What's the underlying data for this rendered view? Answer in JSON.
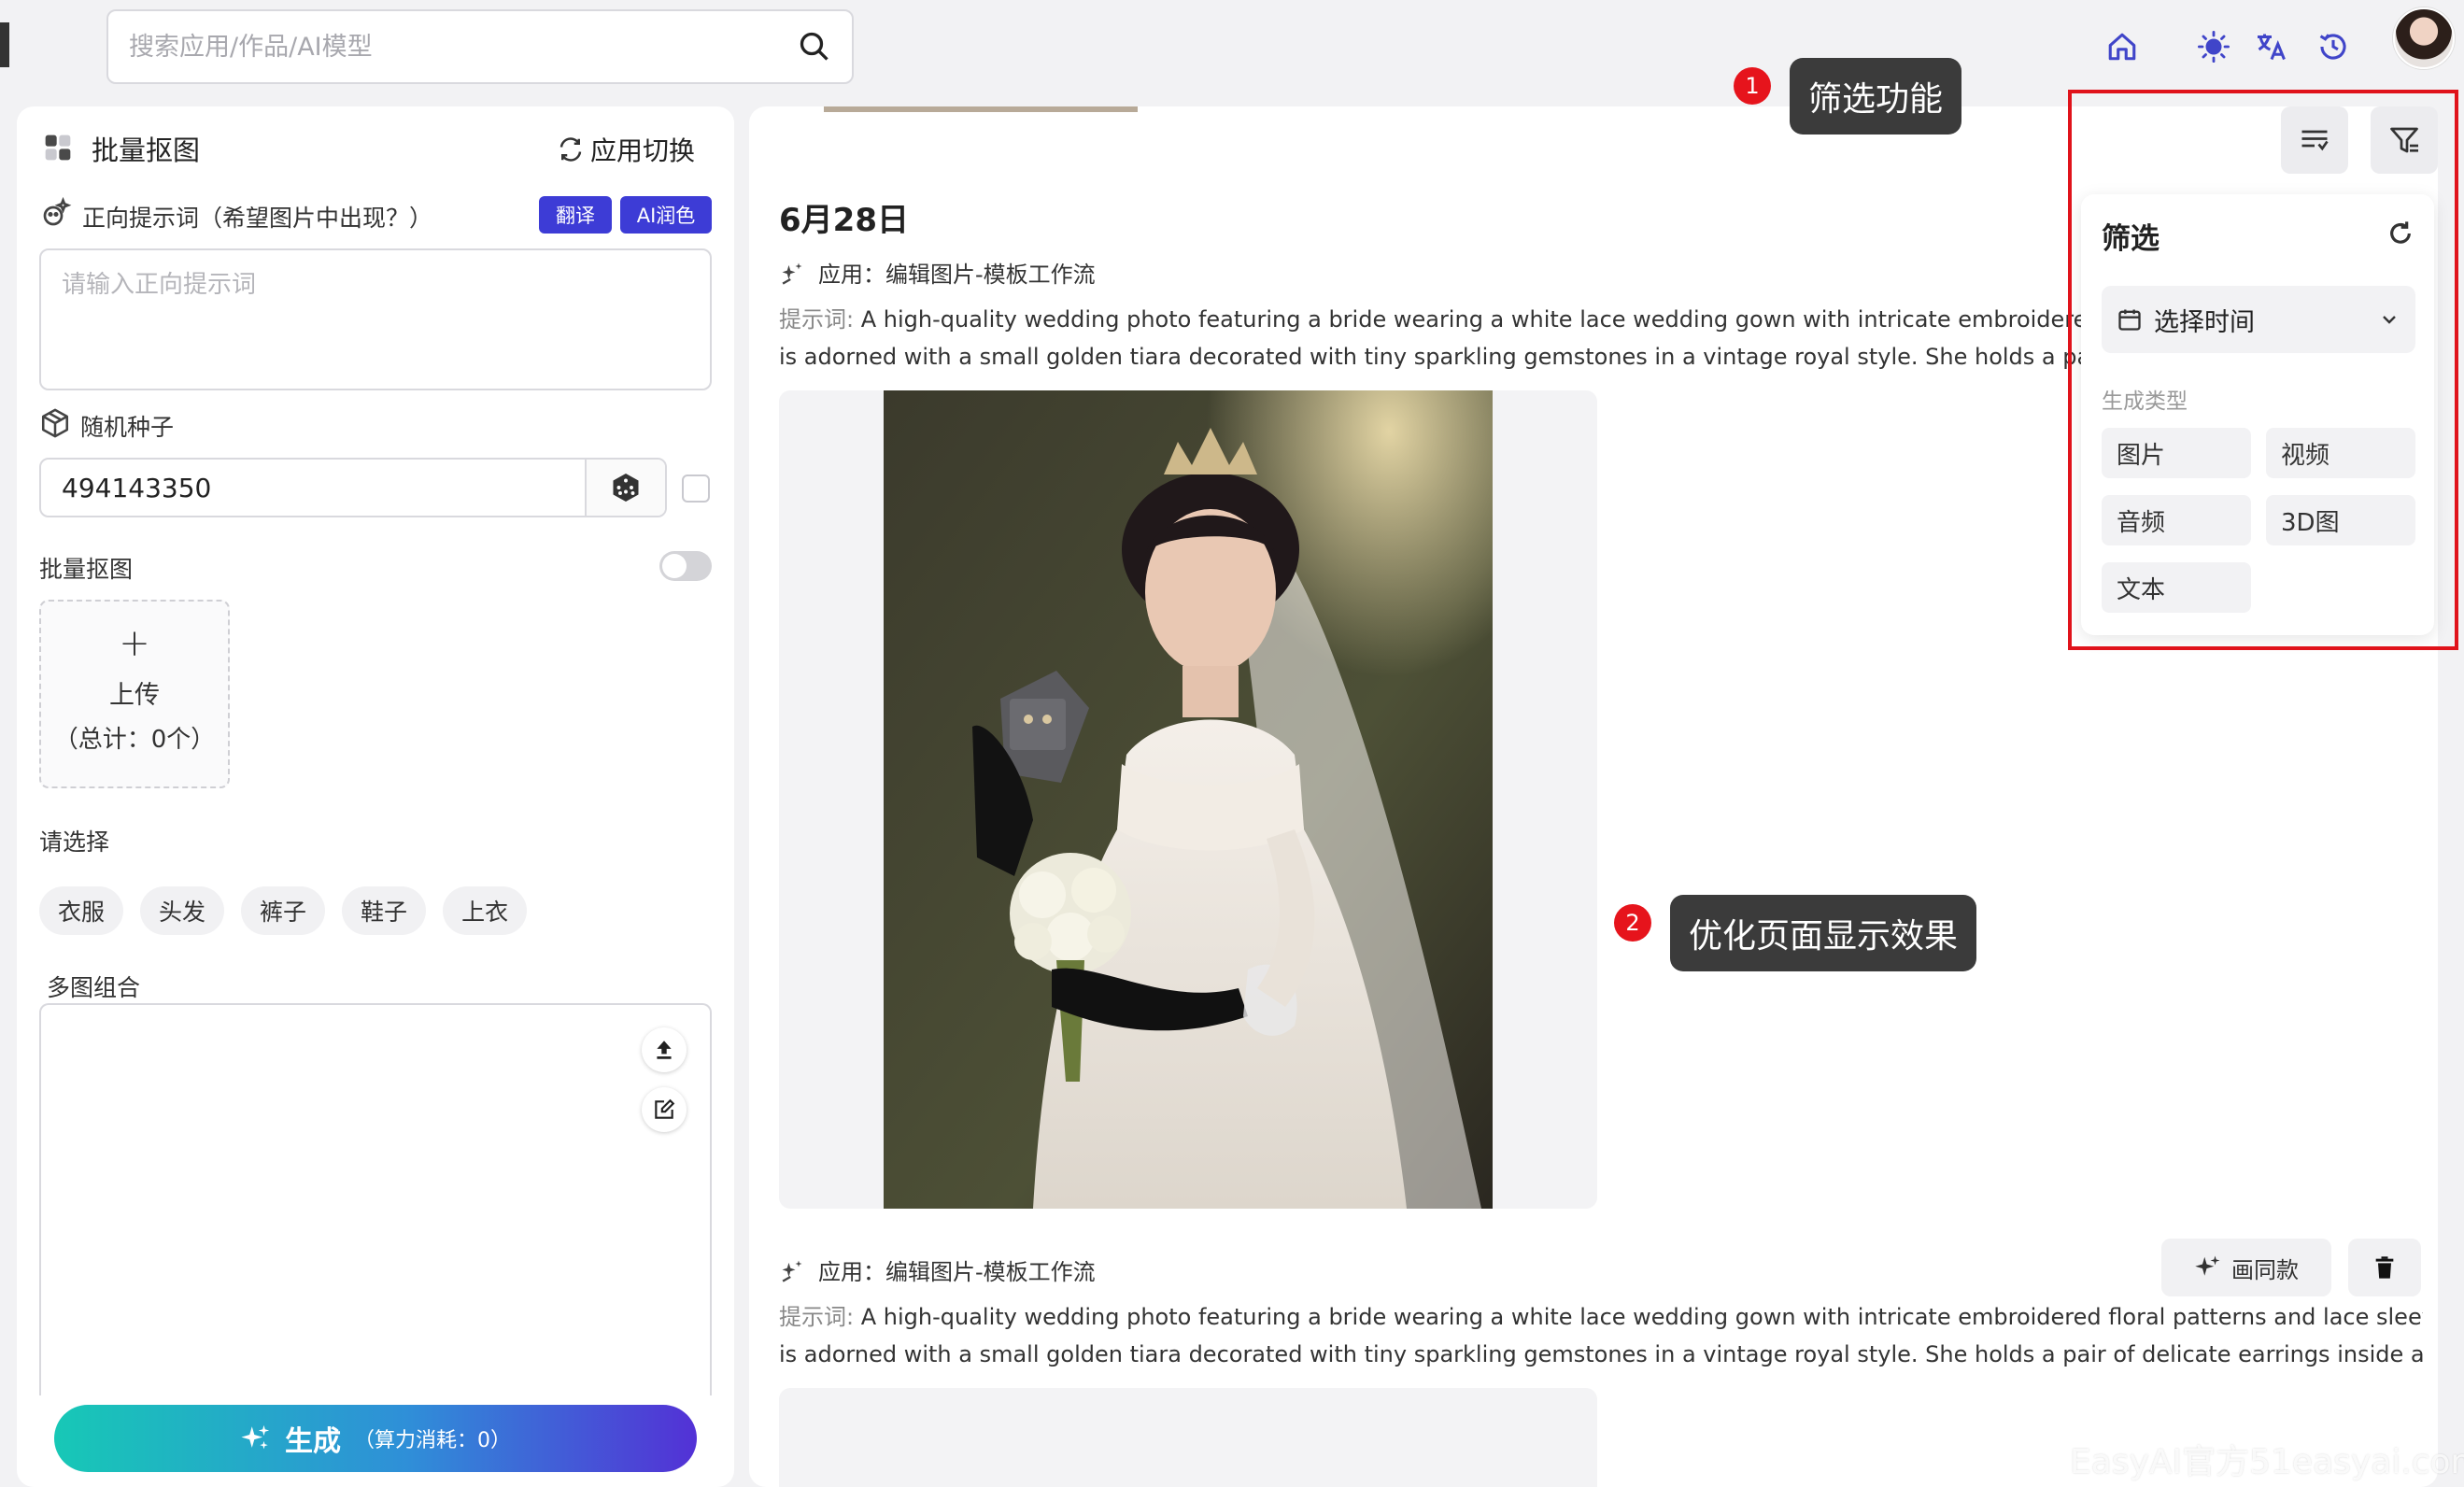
{
  "header": {
    "search_placeholder": "搜索应用/作品/AI模型",
    "icons": [
      "home-icon",
      "sun-icon",
      "translate-icon",
      "history-icon"
    ]
  },
  "left": {
    "title": "批量抠图",
    "switch_label": "应用切换",
    "prompt_label": "正向提示词（希望图片中出现？）",
    "translate_btn": "翻译",
    "polish_btn": "AI润色",
    "prompt_placeholder": "请输入正向提示词",
    "seed_label": "随机种子",
    "seed_value": "494143350",
    "batch_label": "批量抠图",
    "upload_label": "上传",
    "upload_count": "（总计：0个）",
    "select_label": "请选择",
    "options": [
      "衣服",
      "头发",
      "裤子",
      "鞋子",
      "上衣"
    ],
    "multi_label": "多图组合",
    "generate_label": "生成",
    "generate_cost": "（算力消耗：0）"
  },
  "main": {
    "date": "6月28日",
    "entry1": {
      "app": "应用：编辑图片-模板工作流",
      "prompt_key": "提示词:",
      "prompt_line1": "A high-quality wedding photo featuring a bride wearing a white lace wedding gown with intricate embroidered floral",
      "prompt_line2": "is adorned with a small golden tiara decorated with tiny sparkling gemstones in a vintage royal style. She holds a pair of de"
    },
    "entry2": {
      "app": "应用：编辑图片-模板工作流",
      "prompt_key": "提示词:",
      "prompt_line1": "A high-quality wedding photo featuring a bride wearing a white lace wedding gown with intricate embroidered floral patterns and lace sleeves. She",
      "prompt_line2": "is adorned with a small golden tiara decorated with tiny sparkling gemstones in a vintage royal style. She holds a pair of delicate earrings inside a gray...",
      "same_style_btn": "画同款"
    }
  },
  "filter": {
    "title": "筛选",
    "time_select": "选择时间",
    "type_label": "生成类型",
    "types": [
      "图片",
      "视频",
      "音频",
      "3D图",
      "文本"
    ]
  },
  "annotations": {
    "tip1_num": "1",
    "tip1_text": "筛选功能",
    "tip2_num": "2",
    "tip2_text": "优化页面显示效果"
  },
  "watermark": "EasyAI官方51easyai.com",
  "colors": {
    "accent": "#3d3cd6",
    "annotation_red": "#e0131b"
  }
}
